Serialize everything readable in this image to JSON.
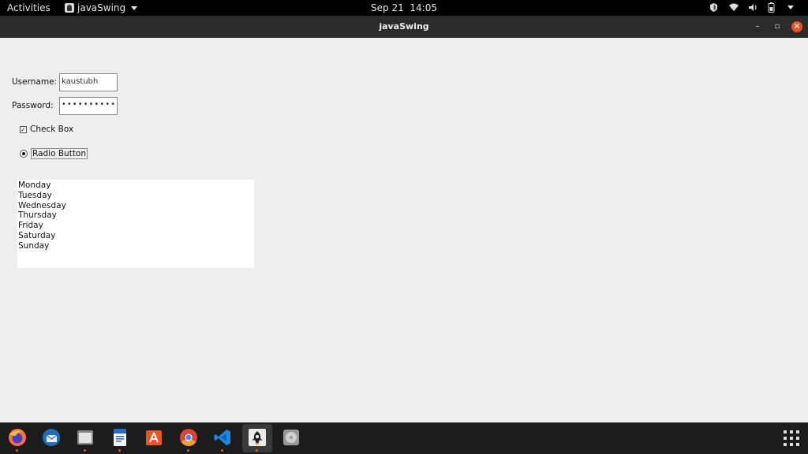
{
  "topbar": {
    "activities": "Activities",
    "app_menu": "javaSwing",
    "date": "Sep 21",
    "time": "14:05"
  },
  "window": {
    "title": "javaSwing"
  },
  "form": {
    "username_label": "Username:",
    "username_value": "kaustubh",
    "password_label": "Password:",
    "password_mask": "•••••••••••••",
    "checkbox_label": "Check Box",
    "checkbox_checked": true,
    "radio_label": "Radio Button",
    "radio_selected": true
  },
  "list": {
    "items": [
      "Monday",
      "Tuesday",
      "Wednesday",
      "Thursday",
      "Friday",
      "Saturday",
      "Sunday"
    ]
  },
  "dock": {
    "apps": [
      "firefox-icon",
      "thunderbird-icon",
      "files-icon",
      "writer-icon",
      "software-icon",
      "chrome-icon",
      "vscode-icon",
      "java-icon",
      "disc-icon"
    ],
    "accent": "#e95420"
  },
  "colors": {
    "close_button": "#e95420",
    "window_bg": "#eeeeee"
  }
}
